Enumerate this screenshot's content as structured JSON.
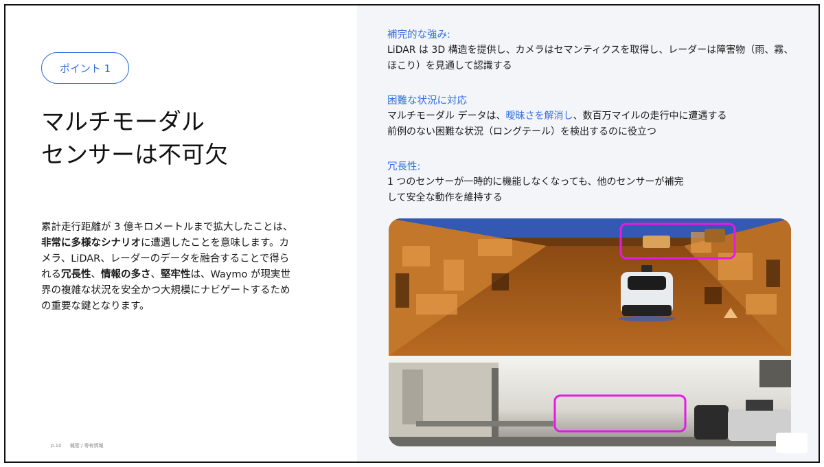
{
  "left": {
    "point_label": "ポイント 1",
    "title_line1": "マルチモーダル",
    "title_line2": "センサーは不可欠",
    "body": {
      "t1": "累計走行距離が 3 億キロメートルまで拡大したことは、",
      "b1": "非常に多様なシナリオ",
      "t2": "に遭遇したことを意味します。カメラ、LiDAR、レーダーのデータを融合することで得られる",
      "b2": "冗長性",
      "t3": "、",
      "b3": "情報の多さ",
      "t4": "、",
      "b4": "堅牢性",
      "t5": "は、Waymo が現実世界の複雑な状況を安全かつ大規模にナビゲートするための重要な鍵となります。"
    },
    "footer_page": "p.10",
    "footer_conf": "機密 / 専有情報"
  },
  "right": {
    "s1_head": "補完的な強み:",
    "s1_body": "LiDAR は 3D 構造を提供し、カメラはセマンティクスを取得し、レーダーは障害物（雨、霧、ほこり）を見通して認識する",
    "s2_head": "困難な状況に対応",
    "s2_pre": "マルチモーダル データは、",
    "s2_hl": "曖昧さを解消し",
    "s2_post": "、数百万マイルの走行中に遭遇する",
    "s2_line2": "前例のない困難な状況（ロングテール）を検出するのに役立つ",
    "s3_head": "冗長性:",
    "s3_line1": "1 つのセンサーが一時的に機能しなくなっても、他のセンサーが補完",
    "s3_line2": "して安全な動作を維持する"
  },
  "colors": {
    "accent": "#2f6fe0",
    "highlight_box": "#e619e6",
    "right_panel_bg": "#f4f5f8"
  },
  "icons": {
    "image": "lidar-camera-fusion-image"
  }
}
